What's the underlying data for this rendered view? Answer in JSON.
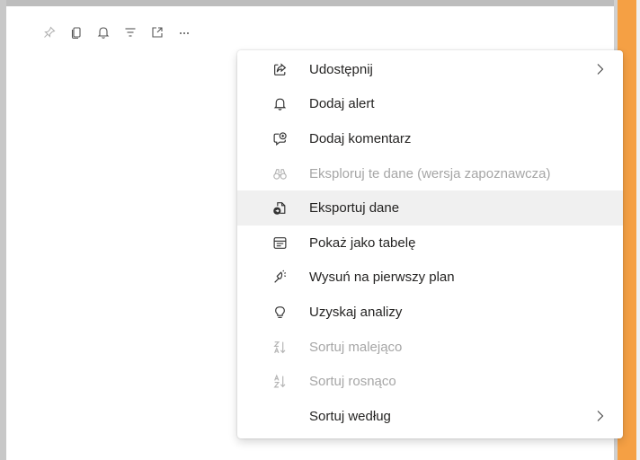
{
  "toolbar": {
    "buttons": [
      {
        "icon": "pin-icon",
        "label": ""
      },
      {
        "icon": "copy-icon",
        "label": ""
      },
      {
        "icon": "bell-icon",
        "label": ""
      },
      {
        "icon": "filter-icon",
        "label": ""
      },
      {
        "icon": "focus-mode-icon",
        "label": ""
      },
      {
        "icon": "more-options-icon",
        "label": "..."
      }
    ]
  },
  "menu": {
    "items": [
      {
        "label": "Udostępnij",
        "icon": "share-icon",
        "disabled": false,
        "submenu": true
      },
      {
        "label": "Dodaj alert",
        "icon": "bell-icon",
        "disabled": false,
        "submenu": false
      },
      {
        "label": "Dodaj komentarz",
        "icon": "comment-icon",
        "disabled": false,
        "submenu": false
      },
      {
        "label": "Eksploruj te dane (wersja zapoznawcza)",
        "icon": "binoculars-icon",
        "disabled": true,
        "submenu": false
      },
      {
        "label": "Eksportuj dane",
        "icon": "export-data-icon",
        "disabled": false,
        "submenu": false,
        "highlighted": true
      },
      {
        "label": "Pokaż jako tabelę",
        "icon": "table-icon",
        "disabled": false,
        "submenu": false
      },
      {
        "label": "Wysuń na pierwszy plan",
        "icon": "spotlight-icon",
        "disabled": false,
        "submenu": false
      },
      {
        "label": "Uzyskaj analizy",
        "icon": "lightbulb-icon",
        "disabled": false,
        "submenu": false
      },
      {
        "label": "Sortuj malejąco",
        "icon": "sort-descending-icon",
        "disabled": true,
        "submenu": false
      },
      {
        "label": "Sortuj rosnąco",
        "icon": "sort-ascending-icon",
        "disabled": true,
        "submenu": false
      },
      {
        "label": "Sortuj według",
        "icon": "",
        "disabled": false,
        "submenu": true
      }
    ]
  },
  "colors": {
    "accent_orange": "#f5a044",
    "text": "#252423",
    "disabled_text": "#a6a6a6",
    "highlight_bg": "#f0f0f0"
  }
}
